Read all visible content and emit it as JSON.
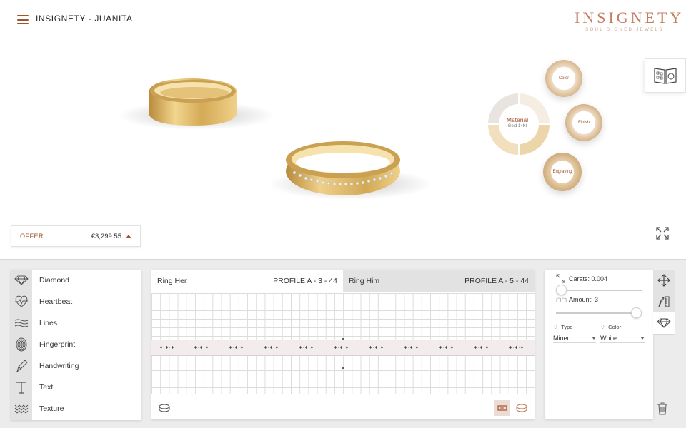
{
  "header": {
    "title": "INSIGNETY - JUANITA",
    "brand_name": "INSIGNETY",
    "brand_tagline": "SOUL SIGNED JEWELS"
  },
  "configurator": {
    "material_label": "Material",
    "material_value": "Gold 14Kt",
    "options": [
      "Color",
      "Finish",
      "Engraving"
    ]
  },
  "offer": {
    "label": "OFFER",
    "price": "€3,299.55"
  },
  "tools": [
    {
      "label": "Diamond",
      "icon": "diamond-icon"
    },
    {
      "label": "Heartbeat",
      "icon": "heartbeat-icon"
    },
    {
      "label": "Lines",
      "icon": "lines-icon"
    },
    {
      "label": "Fingerprint",
      "icon": "fingerprint-icon"
    },
    {
      "label": "Handwriting",
      "icon": "pen-icon"
    },
    {
      "label": "Text",
      "icon": "text-icon"
    },
    {
      "label": "Texture",
      "icon": "texture-icon"
    }
  ],
  "editor": {
    "tabs": [
      {
        "label": "Ring Her",
        "value": "PROFILE A - 3 - 44"
      },
      {
        "label": "Ring Him",
        "value": "PROFILE A - 5 - 44"
      }
    ]
  },
  "properties": {
    "carats_label": "Carats: 0.004",
    "amount_label": "Amount: 3",
    "carats_level": 0.0,
    "amount_level": 1.0,
    "type_label": "Type",
    "type_value": "Mined",
    "color_label": "Color",
    "color_value": "White"
  },
  "colors": {
    "accent": "#a0522d",
    "brand": "#c47d5e",
    "gold": "#d9b66b"
  }
}
